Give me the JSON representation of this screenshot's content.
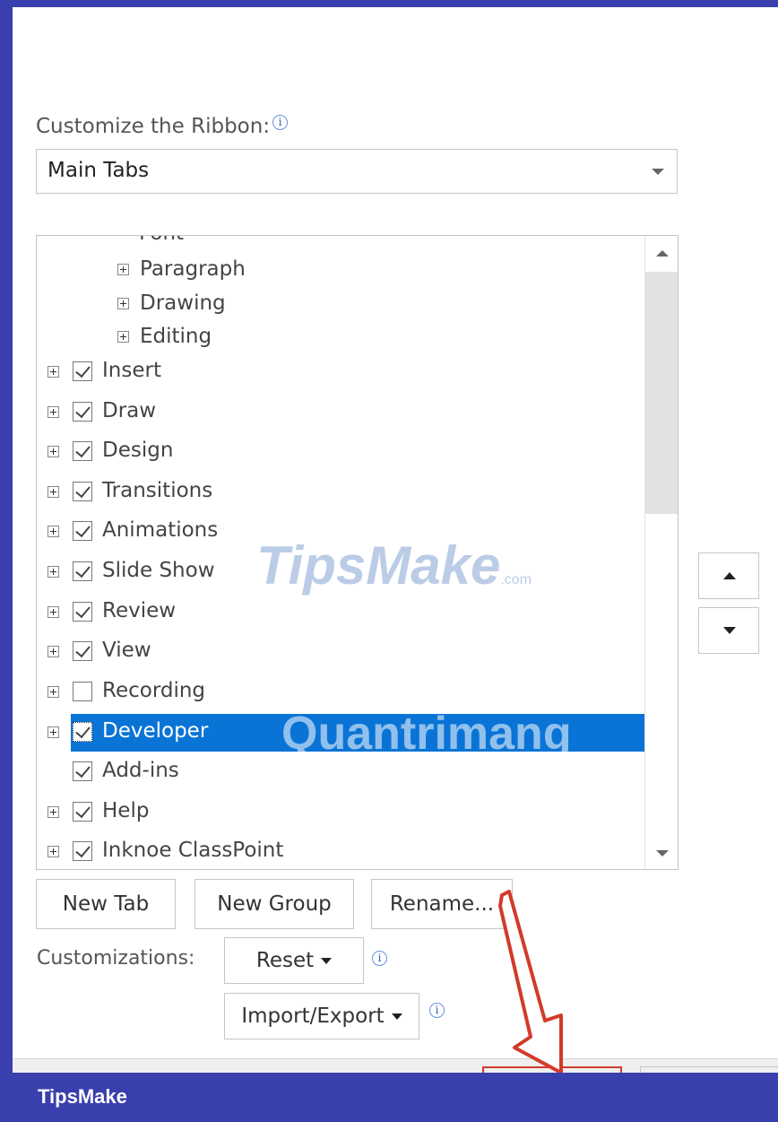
{
  "ribbon": {
    "label": "Customize the Ribbon:",
    "dropdown_value": "Main Tabs"
  },
  "tree": {
    "partial_item": "Font",
    "sub_items": [
      "Paragraph",
      "Drawing",
      "Editing"
    ],
    "items": [
      {
        "label": "Insert",
        "checked": true,
        "expandable": true,
        "selected": false
      },
      {
        "label": "Draw",
        "checked": true,
        "expandable": true,
        "selected": false
      },
      {
        "label": "Design",
        "checked": true,
        "expandable": true,
        "selected": false
      },
      {
        "label": "Transitions",
        "checked": true,
        "expandable": true,
        "selected": false
      },
      {
        "label": "Animations",
        "checked": true,
        "expandable": true,
        "selected": false
      },
      {
        "label": "Slide Show",
        "checked": true,
        "expandable": true,
        "selected": false
      },
      {
        "label": "Review",
        "checked": true,
        "expandable": true,
        "selected": false
      },
      {
        "label": "View",
        "checked": true,
        "expandable": true,
        "selected": false
      },
      {
        "label": "Recording",
        "checked": false,
        "expandable": true,
        "selected": false
      },
      {
        "label": "Developer",
        "checked": true,
        "expandable": true,
        "selected": true
      },
      {
        "label": "Add-ins",
        "checked": true,
        "expandable": false,
        "selected": false
      },
      {
        "label": "Help",
        "checked": true,
        "expandable": true,
        "selected": false
      },
      {
        "label": "Inknoe ClassPoint",
        "checked": true,
        "expandable": true,
        "selected": false
      }
    ]
  },
  "buttons": {
    "new_tab": "New Tab",
    "new_group": "New Group",
    "rename": "Rename...",
    "reset": "Reset",
    "import_export": "Import/Export"
  },
  "customizations_label": "Customizations:",
  "watermarks": {
    "tipsmake": "TipsMake",
    "tipsmake_suffix": ".com",
    "quantrimang": "Quantrimang"
  },
  "footer": {
    "brand": "TipsMake"
  },
  "colors": {
    "selection": "#0a74d6",
    "frame": "#3a3fae",
    "arrow": "#d23a2a"
  }
}
